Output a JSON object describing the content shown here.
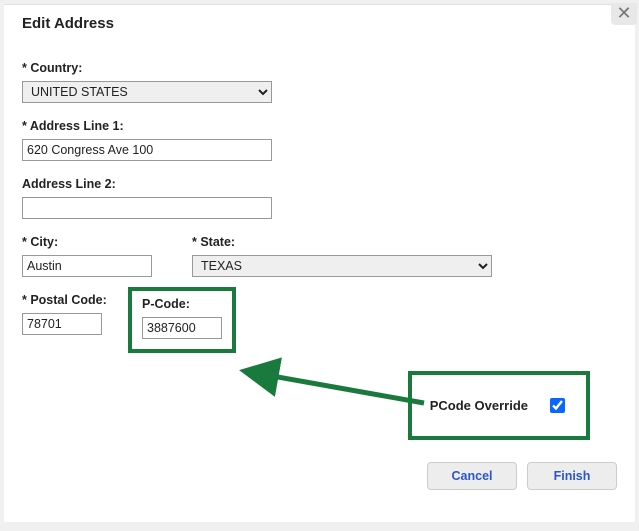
{
  "dialog": {
    "title": "Edit Address",
    "closeGlyph": "✕"
  },
  "fields": {
    "country": {
      "label": "* Country:",
      "value": "UNITED STATES"
    },
    "address1": {
      "label": "* Address Line 1:",
      "value": "620 Congress Ave 100"
    },
    "address2": {
      "label": "Address Line 2:",
      "value": ""
    },
    "city": {
      "label": "* City:",
      "value": "Austin"
    },
    "state": {
      "label": "* State:",
      "value": "TEXAS"
    },
    "postal": {
      "label": "* Postal Code:",
      "value": "78701"
    },
    "pcode": {
      "label": "P-Code:",
      "value": "3887600"
    }
  },
  "override": {
    "label": "PCode Override",
    "checked": true
  },
  "actions": {
    "cancel": "Cancel",
    "finish": "Finish"
  },
  "annotation": {
    "highlightColor": "#1a7a3e"
  }
}
